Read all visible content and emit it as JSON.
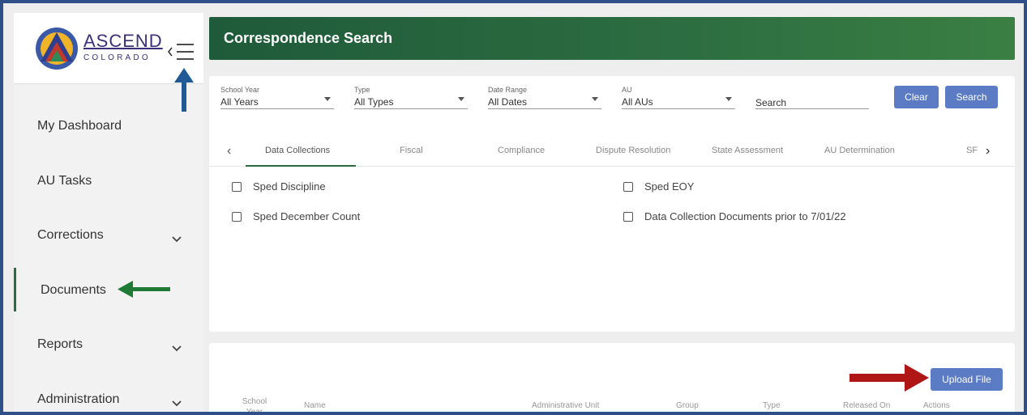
{
  "brand": {
    "name": "ASCEND",
    "subtitle": "COLORADO"
  },
  "sidebar": {
    "items": [
      {
        "label": "My Dashboard"
      },
      {
        "label": "AU Tasks"
      },
      {
        "label": "Corrections"
      },
      {
        "label": "Documents"
      },
      {
        "label": "Reports"
      },
      {
        "label": "Administration"
      }
    ]
  },
  "header": {
    "title": "Correspondence Search"
  },
  "filters": {
    "school_year": {
      "label": "School Year",
      "value": "All Years"
    },
    "type": {
      "label": "Type",
      "value": "All Types"
    },
    "date_range": {
      "label": "Date Range",
      "value": "All Dates"
    },
    "au": {
      "label": "AU",
      "value": "All AUs"
    },
    "search": {
      "placeholder": "Search"
    },
    "clear_label": "Clear",
    "search_label": "Search"
  },
  "tabs": {
    "items": [
      "Data Collections",
      "Fiscal",
      "Compliance",
      "Dispute Resolution",
      "State Assessment",
      "AU Determination",
      "SF"
    ],
    "active": "Data Collections"
  },
  "checkboxes": {
    "items": [
      "Sped Discipline",
      "Sped EOY",
      "Sped December Count",
      "Data Collection Documents prior to 7/01/22"
    ]
  },
  "results": {
    "upload_label": "Upload File",
    "columns": [
      "School Year",
      "Name",
      "Administrative Unit",
      "Group",
      "Type",
      "Released On",
      "Actions"
    ]
  },
  "colors": {
    "accent_green": "#2d6a3e",
    "button_blue": "#5b7bc4",
    "frame_blue": "#2f4f88",
    "annotation_blue": "#1f5a94",
    "annotation_green": "#1e7a34",
    "annotation_red": "#b01616"
  }
}
